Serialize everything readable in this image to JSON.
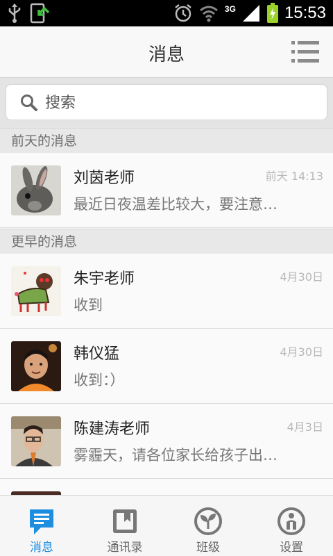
{
  "status_bar": {
    "network": "3G",
    "time": "15:53"
  },
  "header": {
    "title": "消息"
  },
  "search": {
    "placeholder": "搜索"
  },
  "sections": [
    {
      "label": "前天的消息"
    },
    {
      "label": "更早的消息"
    }
  ],
  "messages": [
    {
      "name": "刘茵老师",
      "preview": "最近日夜温差比较大，要注意…",
      "time": "前天 14:13"
    },
    {
      "name": "朱宇老师",
      "preview": "收到",
      "time": "4月30日"
    },
    {
      "name": "韩仪猛",
      "preview": "收到：）",
      "time": "4月30日"
    },
    {
      "name": "陈建涛老师",
      "preview": "雾霾天，请各位家长给孩子出…",
      "time": "4月3日"
    }
  ],
  "tabs": [
    {
      "label": "消息",
      "icon": "chat-icon",
      "active": true
    },
    {
      "label": "通讯录",
      "icon": "contacts-icon",
      "active": false
    },
    {
      "label": "班级",
      "icon": "class-icon",
      "active": false
    },
    {
      "label": "设置",
      "icon": "settings-icon",
      "active": false
    }
  ],
  "colors": {
    "accent": "#1e8fe0",
    "battery": "#9bd22a"
  }
}
